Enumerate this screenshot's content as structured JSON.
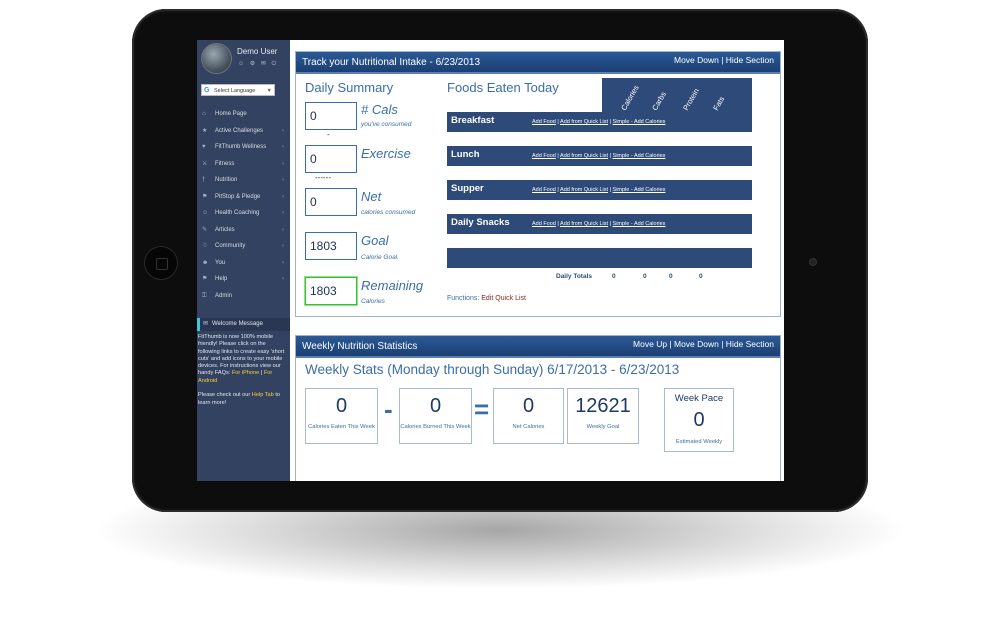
{
  "user": {
    "name": "Demo User",
    "icons": "☺ ⚙ ✉ ⏻"
  },
  "language": {
    "label": "Select Language",
    "g": "G",
    "arrow": "▼"
  },
  "nav": [
    {
      "label": "Home Page",
      "icon": "⌂",
      "chev": ""
    },
    {
      "label": "Active Challenges",
      "icon": "★",
      "chev": "‹"
    },
    {
      "label": "FitThumb Wellness",
      "icon": "♥",
      "chev": "‹"
    },
    {
      "label": "Fitness",
      "icon": "⚔",
      "chev": "‹"
    },
    {
      "label": "Nutrition",
      "icon": "†",
      "chev": "‹"
    },
    {
      "label": "PitStop & Pledge",
      "icon": "⚑",
      "chev": "‹"
    },
    {
      "label": "Health Coaching",
      "icon": "☺",
      "chev": "‹"
    },
    {
      "label": "Articles",
      "icon": "✎",
      "chev": "‹"
    },
    {
      "label": "Community",
      "icon": "☃",
      "chev": "‹"
    },
    {
      "label": "You",
      "icon": "☻",
      "chev": "‹"
    },
    {
      "label": "Help",
      "icon": "⚑",
      "chev": "‹"
    },
    {
      "label": "Admin",
      "icon": "⚿",
      "chev": ""
    }
  ],
  "welcome": {
    "title": "Welcome Message",
    "icon": "✉",
    "body1": "FitThumb is now 100% mobile friendly! Please click on the following links to create easy 'short cuts' and add icons to your mobile devices. For instructions view our handy FAQs: ",
    "link_iphone": "For iPhone",
    "sep": " | ",
    "link_android": "For Android",
    "body2": "Please check out our ",
    "help_tab": "Help Tab",
    "body3": " to learn more!"
  },
  "intake": {
    "title": "Track your Nutritional Intake - 6/23/2013",
    "tools": "Move Down | Hide Section",
    "daily_summary": "Daily Summary",
    "cals_value": "0",
    "cals_label": "# Cals",
    "cals_sub": "you've consumed",
    "minus": "-",
    "exercise_value": "0",
    "exercise_label": "Exercise",
    "dashes": "------",
    "net_value": "0",
    "net_label": "Net",
    "net_sub": "calories consumed",
    "goal_value": "1803",
    "goal_label": "Goal",
    "goal_sub": "Calorie Goal.",
    "remaining_value": "1803",
    "remaining_label": "Remaining",
    "remaining_sub": "Calories",
    "foods_title": "Foods Eaten Today",
    "columns": [
      "Calories",
      "Carbs",
      "Protein",
      "Fats"
    ],
    "meals": [
      {
        "name": "Breakfast"
      },
      {
        "name": "Lunch"
      },
      {
        "name": "Supper"
      },
      {
        "name": "Daily Snacks"
      }
    ],
    "link_add": "Add Food",
    "link_quick": "Add from Quick List",
    "link_simple": "Simple - Add Calories",
    "link_sep": " | ",
    "totals_label": "Daily Totals",
    "totals": [
      "0",
      "0",
      "0",
      "0"
    ],
    "functions_label": "Functions:",
    "functions_link": "Edit Quick List"
  },
  "weekly": {
    "title": "Weekly Nutrition Statistics",
    "tools": "Move Up | Move Down | Hide Section",
    "subtitle": "Weekly Stats (Monday through Sunday) 6/17/2013 - 6/23/2013",
    "eaten_value": "0",
    "eaten_label": "Calories Eaten This Week",
    "minus": "-",
    "burned_value": "0",
    "burned_label": "Calories Burned This Week",
    "equals": "=",
    "net_value": "0",
    "net_label": "Net Calories",
    "goal_value": "12621",
    "goal_label": "Weekly Goal",
    "pace_title": "Week Pace",
    "pace_value": "0",
    "pace_label": "Estimated Weekly"
  }
}
